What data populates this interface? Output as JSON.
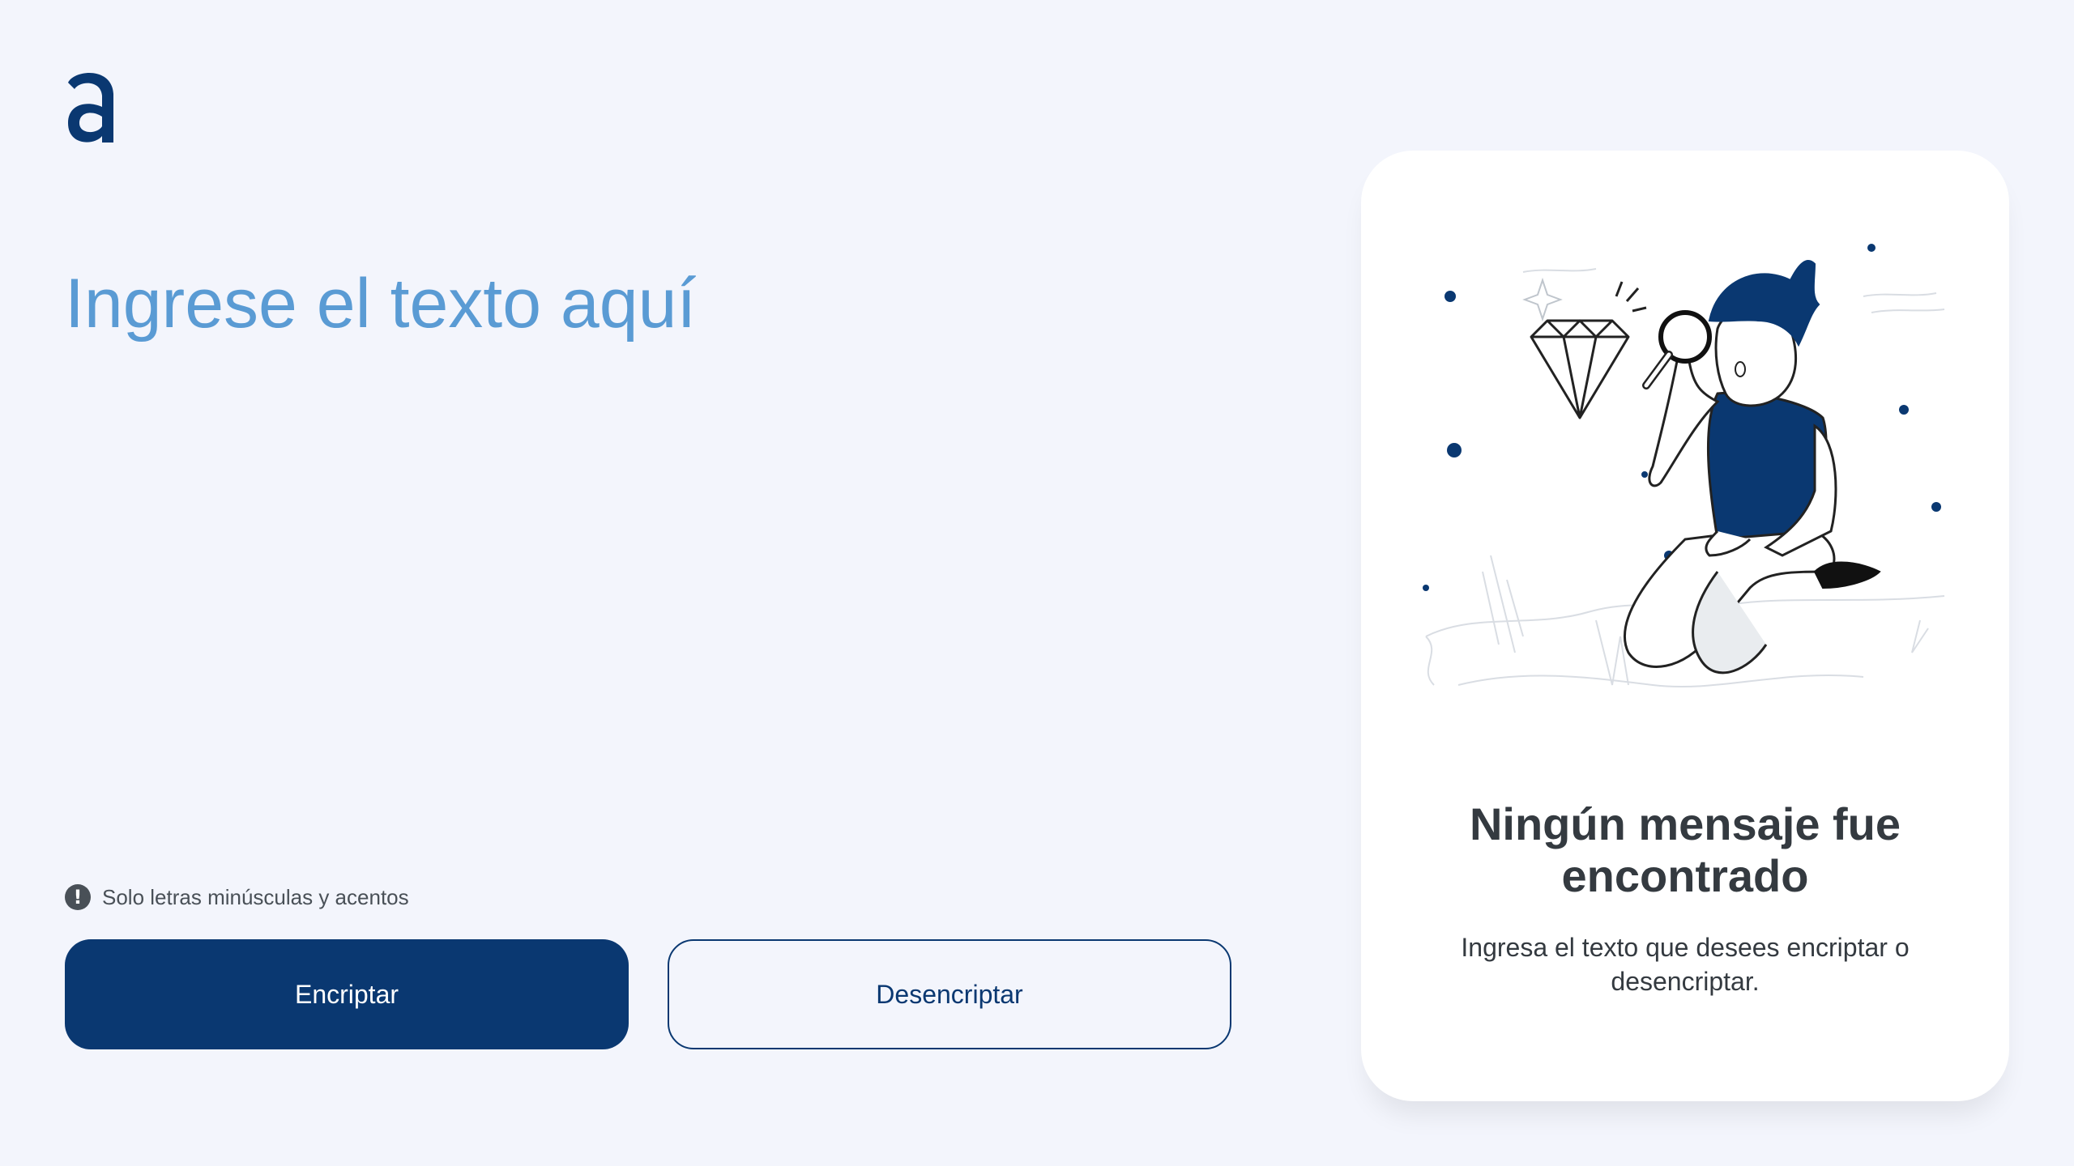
{
  "input": {
    "placeholder": "Ingrese el texto aquí",
    "value": ""
  },
  "hint": {
    "icon": "exclamation-circle-icon",
    "text": "Solo letras minúsculas y acentos"
  },
  "buttons": {
    "encrypt_label": "Encriptar",
    "decrypt_label": "Desencriptar"
  },
  "output_card": {
    "title": "Ningún mensaje fue encontrado",
    "text": "Ingresa el texto que desees encriptar o desencriptar."
  },
  "colors": {
    "background": "#f3f5fc",
    "primary": "#0a3871",
    "placeholder": "#5a9bd4",
    "card": "#ffffff",
    "text": "#343a40"
  }
}
